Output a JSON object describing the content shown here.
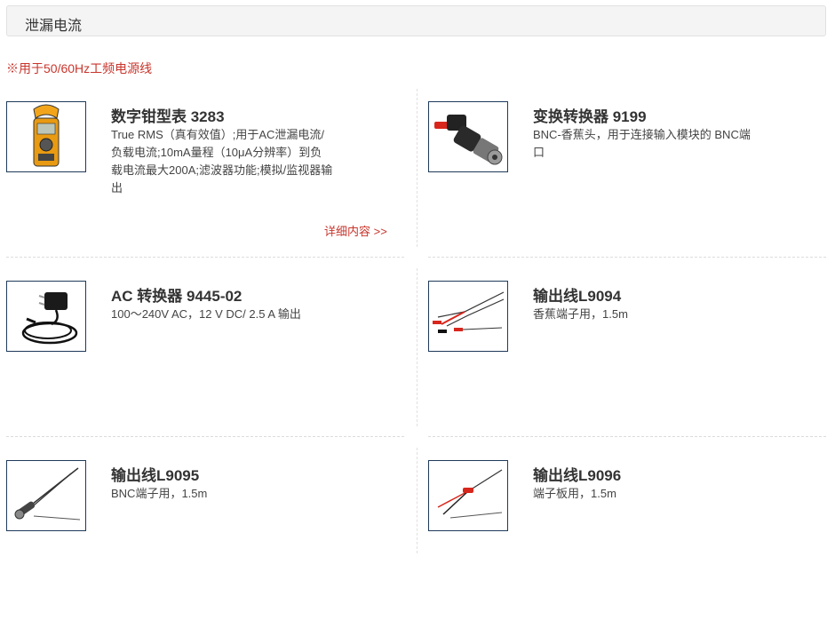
{
  "section": {
    "title": "泄漏电流"
  },
  "note": "※用于50/60Hz工频电源线",
  "products": [
    {
      "title": "数字钳型表 3283",
      "desc": "True RMS（真有效值）;用于AC泄漏电流/负载电流;10mA量程（10μA分辨率）到负载电流最大200A;滤波器功能;模拟/监视器输出",
      "more": "详细内容 >>"
    },
    {
      "title": "变换转换器 9199",
      "desc": "BNC-香蕉头，用于连接输入模块的 BNC端口"
    },
    {
      "title": "AC 转换器 9445-02",
      "desc": "100～240V AC，12 V DC/ 2.5 A 输出"
    },
    {
      "title": "输出线L9094",
      "desc": "香蕉端子用，1.5m"
    },
    {
      "title": "输出线L9095",
      "desc": "BNC端子用，1.5m"
    },
    {
      "title": "输出线L9096",
      "desc": "端子板用，1.5m"
    }
  ]
}
